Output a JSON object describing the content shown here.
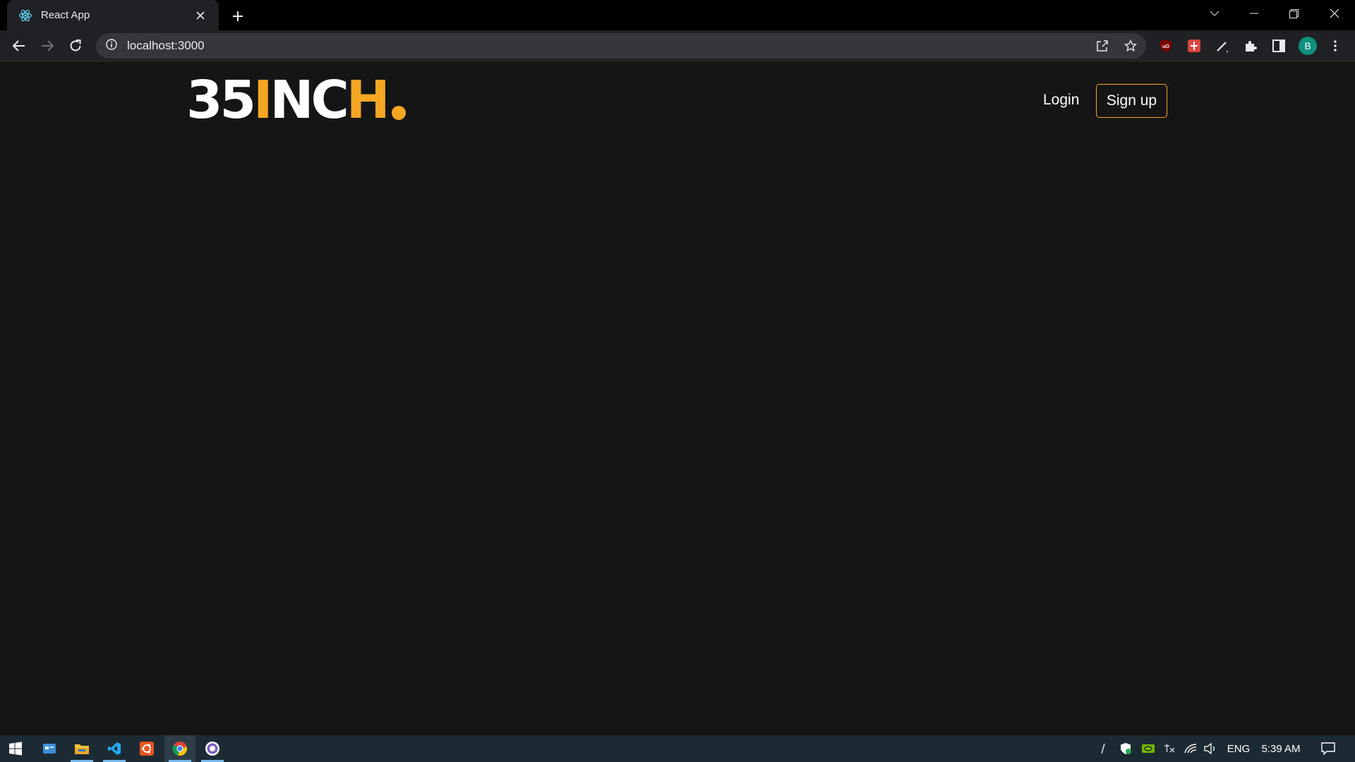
{
  "browser": {
    "tab": {
      "title": "React App",
      "favicon": "react-icon"
    },
    "address": {
      "url": "localhost:3000"
    },
    "profile_initial": "B"
  },
  "site": {
    "logo": {
      "text_part1": "35",
      "text_i": "I",
      "text_n": "N",
      "text_c": "C",
      "text_h": "H",
      "white": "#ffffff",
      "accent": "#f5a623"
    },
    "nav": {
      "login_label": "Login",
      "signup_label": "Sign up"
    }
  },
  "taskbar": {
    "apps": [
      "windows-start-icon",
      "widgets-icon",
      "file-explorer-icon",
      "vscode-icon",
      "ubuntu-icon",
      "chrome-icon",
      "github-desktop-icon"
    ],
    "language": "ENG",
    "time": "5:39 AM"
  },
  "colors": {
    "background": "#151515",
    "accent": "#f5a623",
    "chrome_dark": "#202124"
  }
}
